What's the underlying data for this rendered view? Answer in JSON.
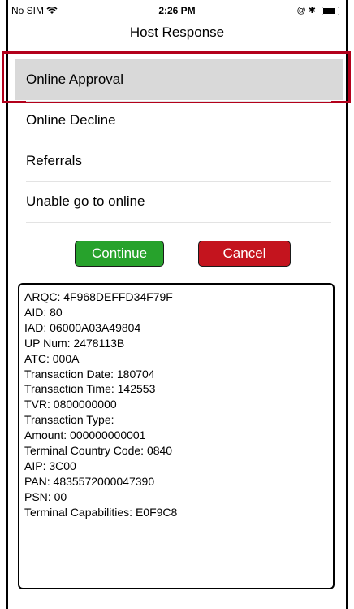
{
  "status_bar": {
    "carrier": "No SIM",
    "wifi_icon": "wifi-icon",
    "time": "2:26 PM",
    "right_icons": "@ ✱"
  },
  "nav": {
    "title": "Host Response"
  },
  "options": [
    {
      "label": "Online Approval",
      "selected": true
    },
    {
      "label": "Online Decline"
    },
    {
      "label": "Referrals"
    },
    {
      "label": "Unable go to online"
    }
  ],
  "buttons": {
    "continue_label": "Continue",
    "cancel_label": "Cancel",
    "continue_color": "#27a22c",
    "cancel_color": "#c4141e"
  },
  "log_lines": [
    "ARQC: 4F968DEFFD34F79F",
    "AID: 80",
    "IAD: 06000A03A49804",
    "UP Num: 2478113B",
    "ATC: 000A",
    "Transaction Date: 180704",
    "Transaction Time: 142553",
    "TVR: 0800000000",
    "Transaction Type:",
    "Amount: 000000000001",
    "Terminal Country Code: 0840",
    "AIP: 3C00",
    "PAN: 4835572000047390",
    "PSN: 00",
    "Terminal Capabilities: E0F9C8"
  ]
}
